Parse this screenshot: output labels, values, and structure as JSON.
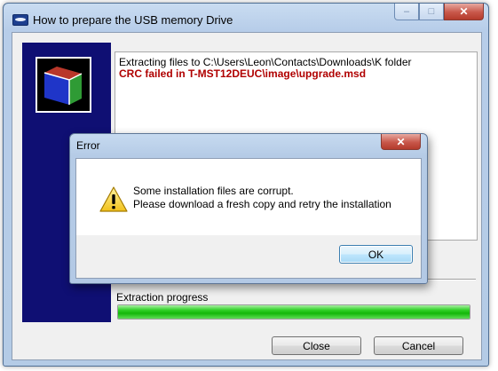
{
  "window": {
    "title": "How to prepare the USB memory Drive",
    "caption_min": "–",
    "caption_max": "□",
    "caption_close": "✕"
  },
  "log": {
    "lines": [
      "Extracting files to C:\\Users\\Leon\\Contacts\\Downloads\\K folder",
      "CRC failed in T-MST12DEUC\\image\\upgrade.msd"
    ]
  },
  "progress": {
    "label": "Extraction progress",
    "value": 1.0
  },
  "buttons": {
    "close": "Close",
    "cancel": "Cancel"
  },
  "error_dialog": {
    "title": "Error",
    "close_glyph": "✕",
    "message_lines": [
      "Some installation files are corrupt.",
      "Please download a fresh copy and retry the installation"
    ],
    "ok": "OK",
    "icon": "warning-icon"
  },
  "colors": {
    "banner": "#0f0f73",
    "error_text": "#b00000",
    "progress_fill": "#13b70a"
  }
}
